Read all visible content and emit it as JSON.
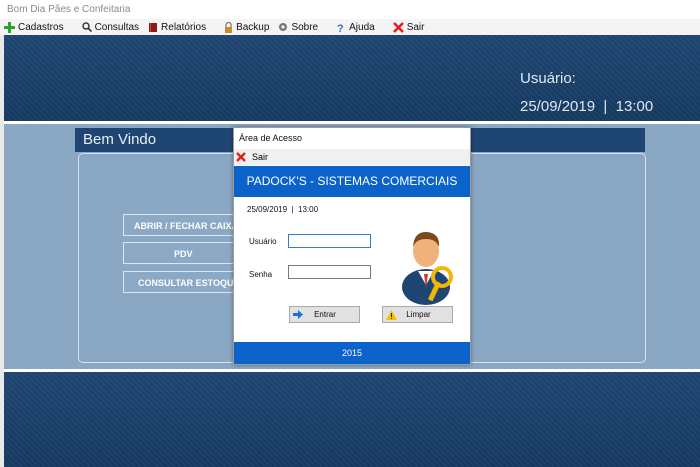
{
  "window": {
    "title": "Bom Dia Pães e Confeitaria"
  },
  "menu": [
    {
      "label": "Cadastros",
      "icon": "plus-icon"
    },
    {
      "label": "Consultas",
      "icon": "magnifier-icon"
    },
    {
      "label": "Relatórios",
      "icon": "book-icon"
    },
    {
      "label": "Backup",
      "icon": "lock-icon"
    },
    {
      "label": "Sobre",
      "icon": "gear-icon"
    },
    {
      "label": "Ajuda",
      "icon": "help-icon"
    },
    {
      "label": "Sair",
      "icon": "red-x-icon"
    }
  ],
  "header": {
    "usuario_label": "Usuário:",
    "datetime": "25/09/2019  |  13:00"
  },
  "welcome": {
    "title": "Bem Vindo"
  },
  "side_buttons": [
    {
      "label": "ABRIR / FECHAR CAIXA"
    },
    {
      "label": "PDV"
    },
    {
      "label": "CONSULTAR ESTOQUE"
    }
  ],
  "dialog": {
    "title": "Área de Acesso",
    "close_label": "Sair",
    "brand": "PADOCK'S - SISTEMAS COMERCIAIS",
    "datetime": "25/09/2019  |  13:00",
    "usuario_label": "Usuário",
    "usuario_value": "",
    "senha_label": "Senha",
    "senha_value": "",
    "enter_label": "Entrar",
    "clear_label": "Limpar",
    "footer": "2015"
  },
  "colors": {
    "header_blue": "#1f4673",
    "dialog_blue": "#0b63c9",
    "panel_bg": "#8aa8c4"
  }
}
